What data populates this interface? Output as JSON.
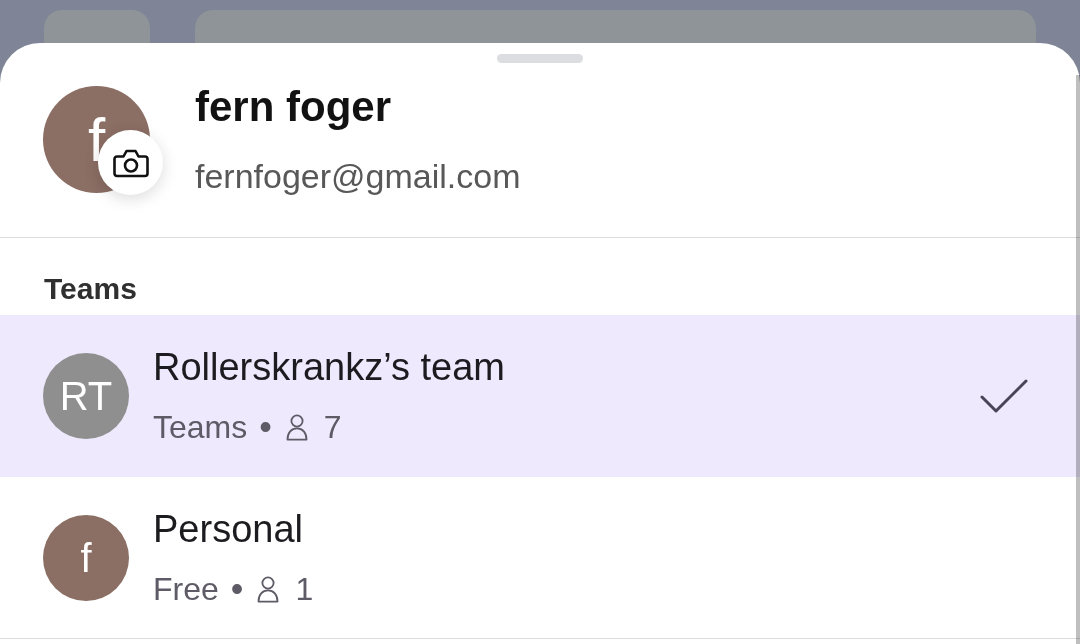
{
  "profile": {
    "avatar_letter": "f",
    "name": "fern foger",
    "email": "fernfoger@gmail.com"
  },
  "section_title": "Teams",
  "teams": [
    {
      "initials": "RT",
      "name": "Rollerskrankz’s team",
      "plan": "Teams",
      "separator": "•",
      "members": "7",
      "selected": true,
      "color": "#8f8f8f"
    },
    {
      "initials": "f",
      "name": "Personal",
      "plan": "Free",
      "separator": "•",
      "members": "1",
      "selected": false,
      "color": "#8b6e64"
    }
  ]
}
